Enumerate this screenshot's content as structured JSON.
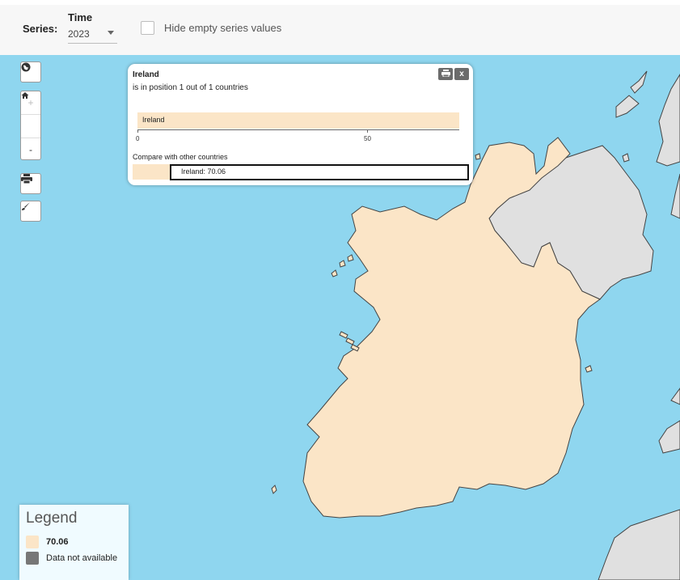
{
  "toolbar": {
    "series_label": "Series:",
    "time_label": "Time",
    "time_value": "2023",
    "hide_empty_label": "Hide empty series values"
  },
  "map_controls": {
    "globe_icon": "globe-icon",
    "zoom_in": "+",
    "home_icon": "home-icon",
    "zoom_out": "-",
    "print_icon": "print-icon",
    "brush_icon": "brush-icon"
  },
  "popup": {
    "country": "Ireland",
    "position_text": "is in position 1 out of 1 countries",
    "bar_label": "Ireland",
    "bar_value": 70.06,
    "axis_ticks": [
      "0",
      "50"
    ],
    "compare_label": "Compare with other countries",
    "compare_value": "Ireland: 70.06",
    "print_button": "print-icon",
    "close_button": "x"
  },
  "legend": {
    "title": "Legend",
    "items": [
      {
        "label": "70.06",
        "color": "#fbe5c7"
      },
      {
        "label": "Data not available",
        "color": "#777777"
      }
    ]
  },
  "colors": {
    "sea": "#8fd6ef",
    "ireland": "#fbe5c7",
    "other_land": "#e0e0e0",
    "border": "#444444"
  }
}
